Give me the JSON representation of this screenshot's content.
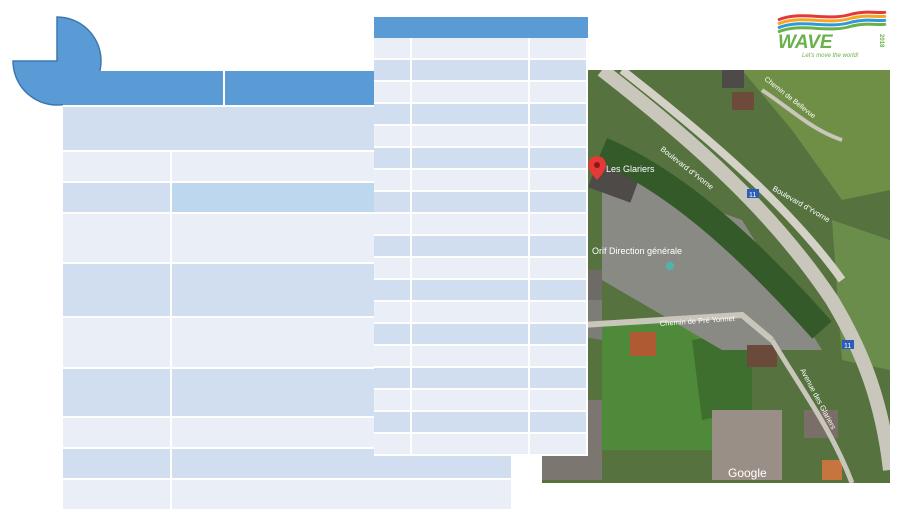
{
  "map": {
    "place_label": "Les Glariers",
    "poi_label": "Orif Direction générale",
    "road_labels": {
      "boulevard_yvorne_1": "Boulevard d'Yvorne",
      "boulevard_yvorne_2": "Boulevard d'Yvorne",
      "chemin_pre_yonnet": "Chemin de Pré Yonnet",
      "avenue_glariers": "Avenue des Glariers",
      "chemin_belle_vue": "Chemin de Bellevue",
      "route_11_a": "11",
      "route_11_b": "11"
    },
    "attribution": "Google"
  },
  "logo": {
    "brand": "WAVE",
    "year": "2018",
    "tagline": "Let's move the world!"
  },
  "colors": {
    "header_blue": "#5b9bd5",
    "row_light": "#e9eef7",
    "row_mid": "#d0deef",
    "row_highlight": "#bdd7ee",
    "map_pin": "#e53935"
  }
}
